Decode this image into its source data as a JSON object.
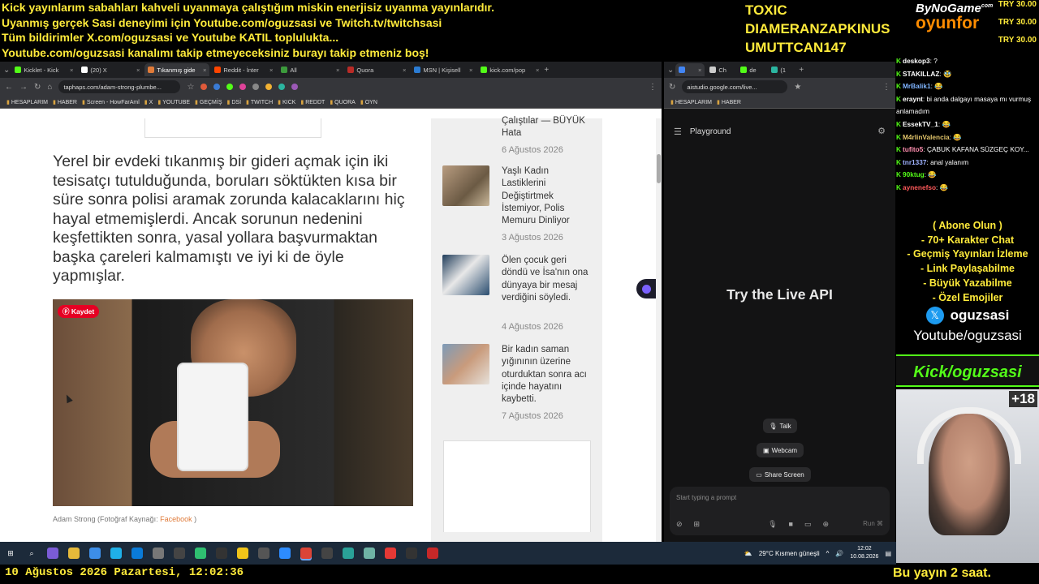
{
  "ticker": [
    "Kick yayınlarım sabahları kahveli uyanmaya çalıştığım miskin enerjisiz uyanma yayınlarıdır.",
    "Uyanmış gerçek Sasi deneyimi için Youtube.com/oguzsasi ve Twitch.tv/twitchsasi",
    "Tüm bildirimler X.com/oguzsasi ve Youtube KATIL toplulukta...",
    "Youtube.com/oguzsasi kanalımı takip etmeyeceksiniz burayı takip etmeniz boş!"
  ],
  "donors": [
    "TOXIC",
    "DIAMERANZAPKINUS",
    "UMUTTCAN147"
  ],
  "logo": {
    "line1": "ByNoGame",
    "sup": "com",
    "line2": "oyunfor"
  },
  "try_amounts": [
    "TRY 30.00",
    "TRY 30.00",
    "TRY 30.00"
  ],
  "browser_a": {
    "tabs": [
      {
        "label": "Kicklet - Kick",
        "color": "#53fc18"
      },
      {
        "label": "(20) X",
        "color": "#ffffff"
      },
      {
        "label": "Tıkanmış gide",
        "color": "#e07b39"
      },
      {
        "label": "Reddit - İnter",
        "color": "#ff4500"
      },
      {
        "label": "All",
        "color": "#3c9a3c"
      },
      {
        "label": "Quora",
        "color": "#b92b27"
      },
      {
        "label": "MSN | Kişisell",
        "color": "#2b7cd3"
      },
      {
        "label": "kick.com/pop",
        "color": "#53fc18"
      }
    ],
    "url": "taphaps.com/adam-strong-plumbe...",
    "bookmarks": [
      "HESAPLARIM",
      "HABER",
      "Screen - HowFarAml",
      "X",
      "YOUTUBE",
      "GEÇMİŞ",
      "DSİ",
      "TWITCH",
      "KICK",
      "REDDT",
      "QUORA",
      "OYN"
    ]
  },
  "article": {
    "text": "Yerel bir evdeki tıkanmış bir gideri açmak için iki tesisatçı tutulduğunda, boruları söktükten kısa bir süre sonra polisi aramak zorunda kalacaklarını hiç hayal etmemişlerdi. Ancak sorunun nedenini keşfettikten sonra, yasal yollara başvurmaktan başka çareleri kalmamıştı ve iyi ki de öyle yapmışlar.",
    "save_label": "Kaydet",
    "caption_prefix": "Adam Strong (Fotoğraf Kaynağı: ",
    "caption_link": "Facebook",
    "caption_suffix": " )"
  },
  "sidebar": {
    "prev_title": "Çalıştılar — BÜYÜK Hata",
    "prev_date": "6 Ağustos 2026",
    "posts": [
      {
        "title": "Yaşlı Kadın Lastiklerini Değiştirtmek İstemiyor, Polis Memuru Dinliyor",
        "date": "3 Ağustos 2026"
      },
      {
        "title": "Ölen çocuk geri döndü ve İsa'nın ona dünyaya bir mesaj verdiğini söyledi.",
        "date": "4 Ağustos 2026"
      },
      {
        "title": "Bir kadın saman yığınının üzerine oturduktan sonra acı içinde hayatını kaybetti.",
        "date": "7 Ağustos 2026"
      }
    ]
  },
  "browser_b": {
    "url": "aistudio.google.com/live...",
    "bookmarks": [
      "HESAPLARIM",
      "HABER"
    ],
    "tabs": [
      "Ch",
      "de",
      "(1"
    ],
    "playground": "Playground",
    "hero": "Try the Live API",
    "buttons": [
      "Talk",
      "Webcam",
      "Share Screen"
    ],
    "prompt_placeholder": "Start typing a prompt",
    "run": "Run ⌘"
  },
  "chat": [
    {
      "user": "deskop3",
      "color": "#ffffff",
      "msg": ": ?"
    },
    {
      "user": "STAKILLAZ",
      "color": "#ffffff",
      "msg": ": 🥸"
    },
    {
      "user": "MrBalik1",
      "color": "#7fb4ff",
      "msg": ": 😂"
    },
    {
      "user": "eraynt",
      "color": "#ffffff",
      "msg": ": bi anda dalgayı masaya mı vurmuş anlamadım"
    },
    {
      "user": "EssekTV_1",
      "color": "#ffffff",
      "msg": ": 😂"
    },
    {
      "user": "M4rlinValencia",
      "color": "#e0c36a",
      "msg": ": 😂"
    },
    {
      "user": "tufito5",
      "color": "#ff8fb0",
      "msg": ": ÇABUK KAFANA SÜZGEÇ KOY..."
    },
    {
      "user": "tnr1337",
      "color": "#9fb3ff",
      "msg": ": anal yalanım"
    },
    {
      "user": "90ktug",
      "color": "#53fc18",
      "msg": ": 😂"
    },
    {
      "user": "aynenefso",
      "color": "#ff5a5a",
      "msg": ": 😂"
    }
  ],
  "promo": [
    "( Abone Olun )",
    "- 70+ Karakter Chat",
    "- Geçmiş Yayınları İzleme",
    "- Link Paylaşabilme",
    "- Büyük Yazabilme",
    "- Özel Emojiler"
  ],
  "social": {
    "handle": "oguzsasi",
    "youtube": "Youtube/oguzsasi",
    "kick": "Kick/oguzsasi"
  },
  "webcam_badge": "+18",
  "taskbar": {
    "weather": "29°C  Kısmen güneşli",
    "time": "12:02",
    "date": "10.08.2026"
  },
  "footer": {
    "left": "10 Ağustos 2026 Pazartesi, 12:02:36",
    "right": "Bu yayın 2 saat."
  }
}
